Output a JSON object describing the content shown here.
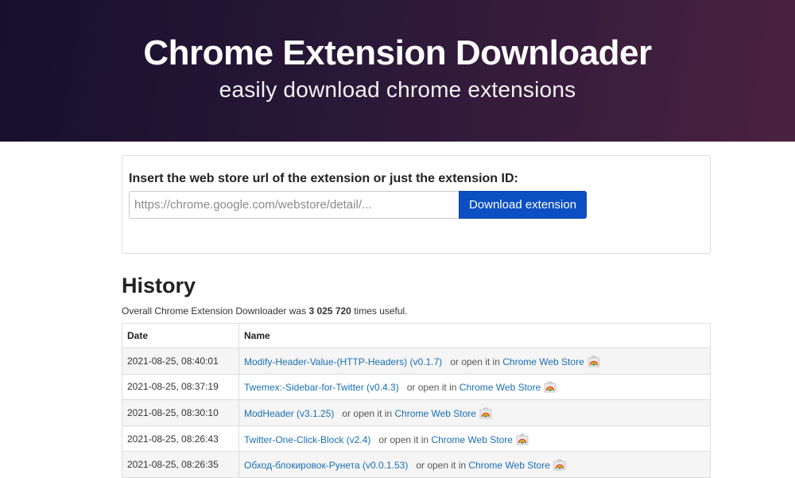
{
  "hero": {
    "title": "Chrome Extension Downloader",
    "subtitle": "easily download chrome extensions"
  },
  "form": {
    "label": "Insert the web store url of the extension or just the extension ID:",
    "input_placeholder": "https://chrome.google.com/webstore/detail/...",
    "input_value": "",
    "button_label": "Download extension"
  },
  "history": {
    "title": "History",
    "overall_prefix": "Overall Chrome Extension Downloader was",
    "overall_count": "3 025 720",
    "overall_suffix": "times useful.",
    "columns": {
      "date": "Date",
      "name": "Name"
    },
    "or_text": "or open it in",
    "store_text": "Chrome Web Store",
    "store_icon": "chrome-web-store-icon",
    "rows": [
      {
        "date": "2021-08-25, 08:40:01",
        "name": "Modify-Header-Value-(HTTP-Headers) (v0.1.7)"
      },
      {
        "date": "2021-08-25, 08:37:19",
        "name": "Twemex:-Sidebar-for-Twitter (v0.4.3)"
      },
      {
        "date": "2021-08-25, 08:30:10",
        "name": "ModHeader (v3.1.25)"
      },
      {
        "date": "2021-08-25, 08:26:43",
        "name": "Twitter-One-Click-Block (v2.4)"
      },
      {
        "date": "2021-08-25, 08:26:35",
        "name": "Обход-блокировок-Рунета (v0.0.1.53)"
      }
    ]
  },
  "colors": {
    "hero_start": "#160f2e",
    "hero_end": "#4a2240",
    "button": "#0b4fc2",
    "link": "#1a6fb5"
  }
}
